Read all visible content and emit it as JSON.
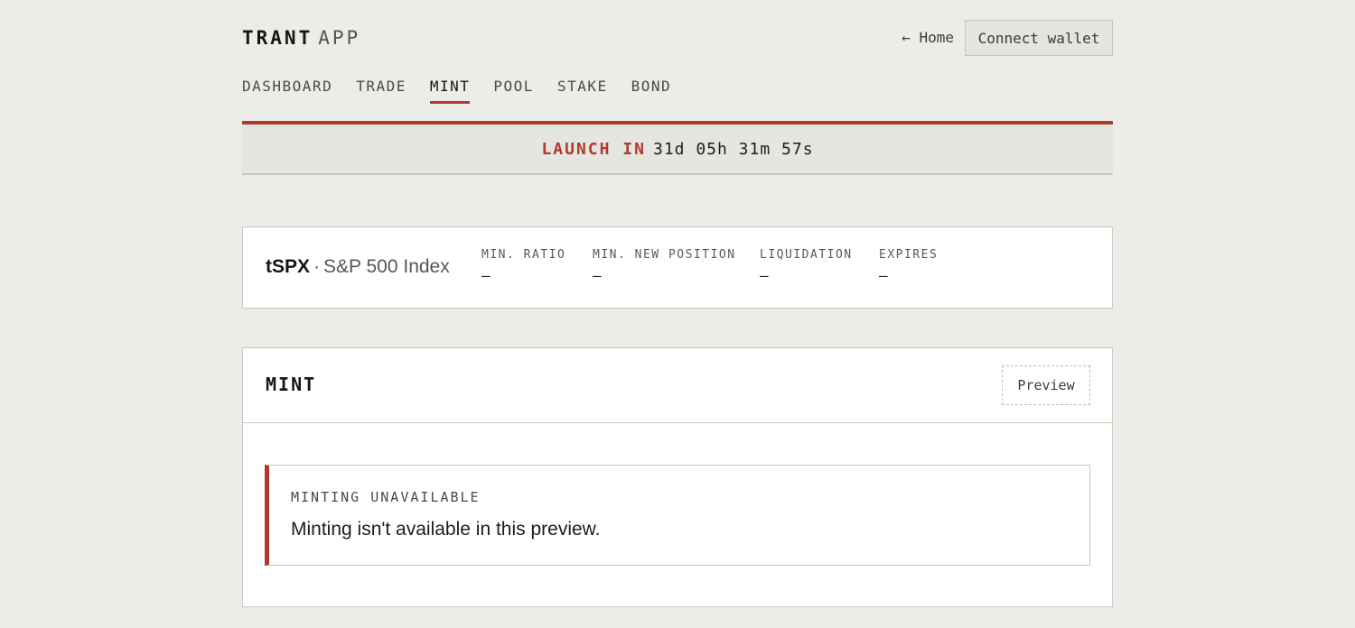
{
  "header": {
    "brand_strong": "TRANT",
    "brand_light": "APP",
    "home_link": "← Home",
    "connect_label": "Connect wallet"
  },
  "nav": {
    "items": [
      "DASHBOARD",
      "TRADE",
      "MINT",
      "POOL",
      "STAKE",
      "BOND"
    ],
    "active": "MINT"
  },
  "launch": {
    "label": "LAUNCH IN",
    "countdown": "31d 05h 31m 57s"
  },
  "market": {
    "ticker": "tSPX",
    "separator": "·",
    "name": "S&P 500 Index",
    "stats": [
      {
        "label": "MIN. RATIO",
        "value": "—"
      },
      {
        "label": "MIN. NEW POSITION",
        "value": "—"
      },
      {
        "label": "LIQUIDATION",
        "value": "—"
      },
      {
        "label": "EXPIRES",
        "value": "—"
      }
    ]
  },
  "mint": {
    "title": "MINT",
    "badge": "Preview",
    "alert_title": "MINTING UNAVAILABLE",
    "alert_body": "Minting isn't available in this preview."
  },
  "colors": {
    "accent": "#b03a2e",
    "background": "#ecede8",
    "card": "#ffffff",
    "border": "#c7c9c2"
  }
}
